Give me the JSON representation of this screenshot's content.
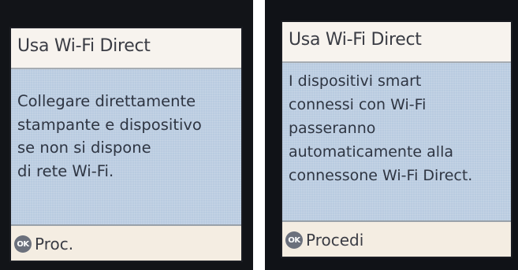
{
  "screens": [
    {
      "title": "Usa Wi-Fi Direct",
      "message": "Collegare direttamente\nstampante e dispositivo\nse non si dispone\ndi rete Wi-Fi.",
      "ok_icon": "OK",
      "ok_label": "Proc."
    },
    {
      "title": "Usa Wi-Fi Direct",
      "message": "I dispositivi smart\nconnessi con Wi-Fi\npasseranno\nautomaticamente alla\nconnessone Wi-Fi Direct.",
      "ok_icon": "OK",
      "ok_label": "Procedi"
    }
  ],
  "colors": {
    "header_bg": "#f7f3ee",
    "body_bg": "#b9cbe0",
    "footer_bg": "#f4ede2",
    "ok_icon_bg": "#6b707c"
  }
}
